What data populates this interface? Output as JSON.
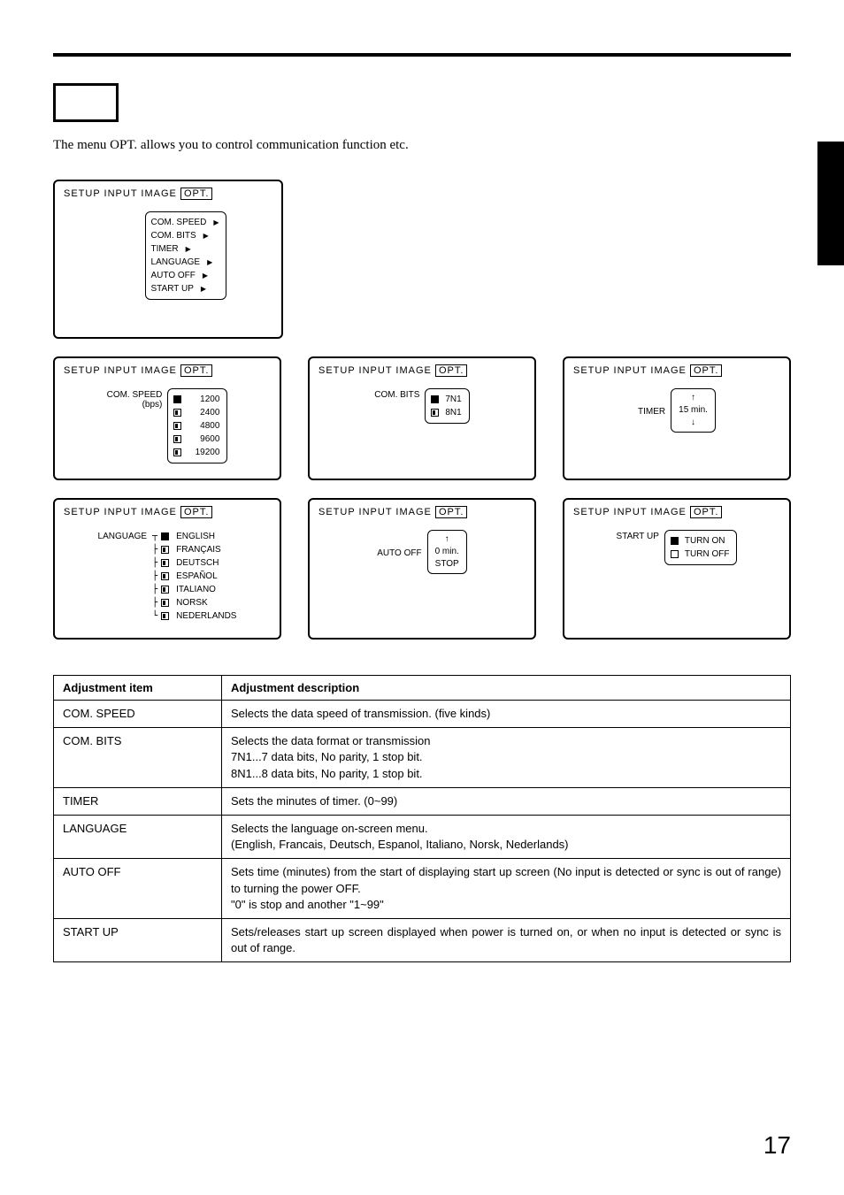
{
  "section_label": "OPT.",
  "description": "The menu OPT. allows you to control communication function etc.",
  "tabs": {
    "setup": "SETUP",
    "input": "INPUT",
    "image": "IMAGE",
    "opt": "OPT."
  },
  "main_menu": {
    "items": [
      "COM. SPEED",
      "COM. BITS",
      "TIMER",
      "LANGUAGE",
      "AUTO  OFF",
      "START UP"
    ]
  },
  "com_speed": {
    "label": "COM. SPEED",
    "unit": "(bps)",
    "options": [
      "1200",
      "2400",
      "4800",
      "9600",
      "19200"
    ]
  },
  "com_bits": {
    "label": "COM. BITS",
    "options": [
      "7N1",
      "8N1"
    ]
  },
  "timer": {
    "label": "TIMER",
    "value": "15  min."
  },
  "language": {
    "label": "LANGUAGE",
    "options": [
      "ENGLISH",
      "FRANÇAIS",
      "DEUTSCH",
      "ESPAÑOL",
      "ITALIANO",
      "NORSK",
      "NEDERLANDS"
    ]
  },
  "auto_off": {
    "label": "AUTO  OFF",
    "value": "0  min.",
    "stop": "STOP"
  },
  "start_up": {
    "label": "START UP",
    "on": "TURN ON",
    "off": "TURN OFF"
  },
  "table": {
    "header": {
      "item": "Adjustment item",
      "desc": "Adjustment description"
    },
    "rows": [
      {
        "item": "COM. SPEED",
        "desc": "Selects the data speed of transmission. (five kinds)"
      },
      {
        "item": "COM. BITS",
        "desc": "Selects the data format or transmission\n7N1...7 data bits, No parity, 1 stop bit.\n8N1...8 data bits, No parity, 1 stop bit."
      },
      {
        "item": "TIMER",
        "desc": "Sets the minutes of timer. (0~99)"
      },
      {
        "item": "LANGUAGE",
        "desc": "Selects the language on-screen menu.\n(English, Francais, Deutsch, Espanol, Italiano, Norsk, Nederlands)"
      },
      {
        "item": "AUTO OFF",
        "desc": "Sets time (minutes) from the start of displaying start up screen (No input is detected or sync is out of range) to turning the power OFF.\n\"0\" is stop and another \"1~99\""
      },
      {
        "item": "START UP",
        "desc": "Sets/releases start up screen displayed when power is turned on, or when no input is detected or sync is out of range."
      }
    ]
  },
  "page_num": "17"
}
